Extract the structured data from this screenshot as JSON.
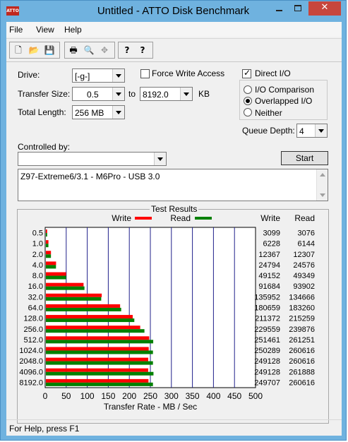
{
  "window": {
    "title": "Untitled - ATTO Disk Benchmark",
    "icon_text": "ATTO",
    "close_glyph": "✕"
  },
  "menu": {
    "items": [
      "File",
      "View",
      "Help"
    ]
  },
  "toolbar": {
    "buttons": [
      {
        "name": "new-icon",
        "glyph": "🗋"
      },
      {
        "name": "open-icon",
        "glyph": "📂"
      },
      {
        "name": "save-icon",
        "glyph": "💾"
      },
      {
        "name": "print-icon",
        "glyph": "🖶"
      },
      {
        "name": "print-preview-icon",
        "glyph": "🔍"
      },
      {
        "name": "move-icon",
        "glyph": "✥"
      },
      {
        "name": "help-icon",
        "glyph": "?"
      },
      {
        "name": "context-help-icon",
        "glyph": "?"
      }
    ]
  },
  "settings": {
    "drive_label": "Drive:",
    "drive_value": "[-g-]",
    "force_write_label": "Force Write Access",
    "force_write_checked": false,
    "direct_io_label": "Direct I/O",
    "direct_io_checked": true,
    "transfer_size_label": "Transfer Size:",
    "transfer_from": "0.5",
    "to_label": "to",
    "transfer_to": "8192.0",
    "kb_label": "KB",
    "total_length_label": "Total Length:",
    "total_length_value": "256 MB",
    "io_mode_options": [
      "I/O Comparison",
      "Overlapped I/O",
      "Neither"
    ],
    "io_mode_selected": "Overlapped I/O",
    "queue_depth_label": "Queue Depth:",
    "queue_depth_value": "4",
    "controlled_by_label": "Controlled by:",
    "controlled_by_value": "",
    "start_button": "Start",
    "description": "Z97-Extreme6/3.1 - M6Pro - USB 3.0"
  },
  "results": {
    "title": "Test Results",
    "write_header": "Write",
    "read_header": "Read",
    "colors": {
      "write": "#ff0000",
      "read": "#008000"
    }
  },
  "chart_data": {
    "type": "bar",
    "title": "Test Results",
    "xlabel": "Transfer Rate - MB / Sec",
    "xlim": [
      0,
      500
    ],
    "x_ticks": [
      "0",
      "50",
      "100",
      "150",
      "200",
      "250",
      "300",
      "350",
      "400",
      "450",
      "500"
    ],
    "categories": [
      "0.5",
      "1.0",
      "2.0",
      "4.0",
      "8.0",
      "16.0",
      "32.0",
      "64.0",
      "128.0",
      "256.0",
      "512.0",
      "1024.0",
      "2048.0",
      "4096.0",
      "8192.0"
    ],
    "series": [
      {
        "name": "Write",
        "color": "#ff0000",
        "values": [
          3099,
          6228,
          12367,
          24794,
          49152,
          91684,
          135952,
          180659,
          211372,
          229559,
          251461,
          250289,
          249128,
          249128,
          249707
        ]
      },
      {
        "name": "Read",
        "color": "#008000",
        "values": [
          3076,
          6144,
          12307,
          24576,
          49349,
          93902,
          134666,
          183260,
          215259,
          239876,
          261251,
          260616,
          260616,
          261888,
          260616
        ]
      }
    ]
  },
  "status": {
    "text": "For Help, press F1"
  }
}
